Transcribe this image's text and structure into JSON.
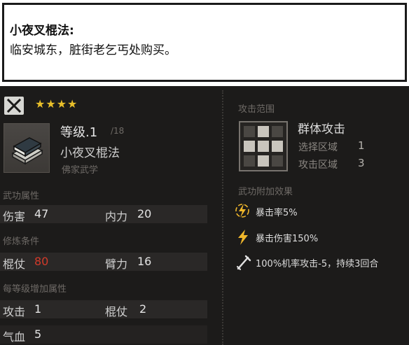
{
  "tooltip": {
    "title": "小夜叉棍法:",
    "description": "临安城东，脏街老乞丐处购买。"
  },
  "header": {
    "stars": "★★★★",
    "level_label": "等级.1",
    "level_max": "/18",
    "skill_name": "小夜叉棍法",
    "school": "佛家武学"
  },
  "attributes": {
    "section_title": "武功属性",
    "damage_label": "伤害",
    "damage_value": "47",
    "neili_label": "内力",
    "neili_value": "20"
  },
  "requirements": {
    "section_title": "修炼条件",
    "staff_label": "棍仗",
    "staff_value": "80",
    "arm_label": "臂力",
    "arm_value": "16"
  },
  "per_level": {
    "section_title": "每等级增加属性",
    "attack_label": "攻击",
    "attack_value": "1",
    "staff_label": "棍仗",
    "staff_value": "2",
    "hp_label": "气血",
    "hp_value": "5"
  },
  "range": {
    "section_title": "攻击范围",
    "type": "群体攻击",
    "select_label": "选择区域",
    "select_value": "1",
    "attack_label": "攻击区域",
    "attack_value": "3"
  },
  "effects": {
    "section_title": "武功附加效果",
    "items": [
      {
        "icon": "crit-rate-icon",
        "text": "暴击率5%"
      },
      {
        "icon": "crit-damage-icon",
        "text": "暴击伤害150%"
      },
      {
        "icon": "attack-debuff-icon",
        "text": "100%机率攻击-5，持续3回合"
      }
    ]
  },
  "colors": {
    "star": "#e8bf2a",
    "unmet_requirement": "#d23a2a",
    "text": "#dcdcdc",
    "dim_text": "#6e6a66"
  }
}
